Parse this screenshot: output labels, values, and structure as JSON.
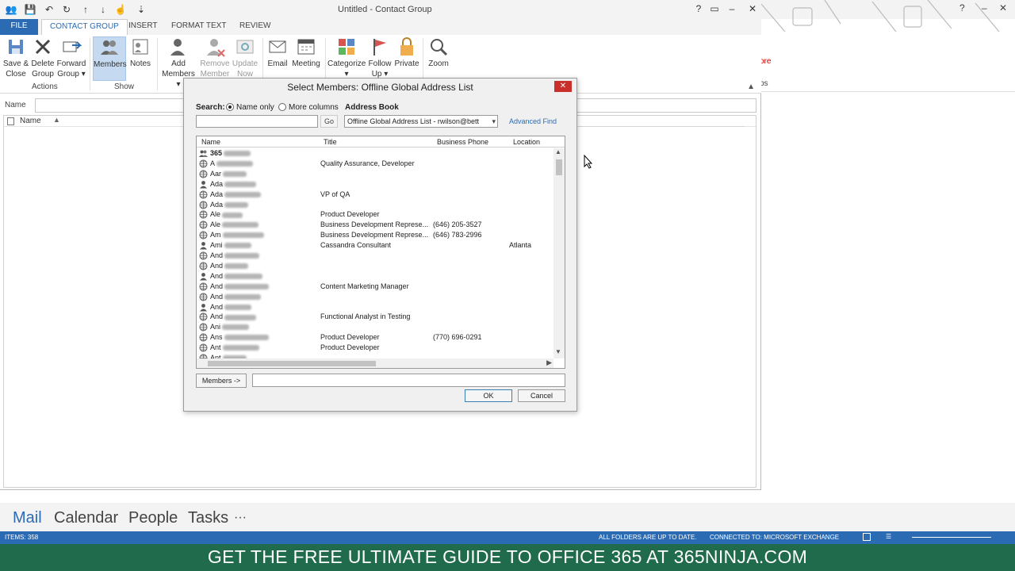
{
  "window": {
    "title": "Untitled - Contact Group",
    "controls": [
      "?",
      "▭",
      "–",
      "☐",
      "✕"
    ]
  },
  "quick_access": [
    "contacts-icon",
    "save-icon",
    "undo-icon",
    "redo-icon",
    "up-icon",
    "down-icon",
    "touch-icon",
    "customize-icon"
  ],
  "tabs": [
    {
      "label": "FILE"
    },
    {
      "label": "CONTACT GROUP"
    },
    {
      "label": "INSERT"
    },
    {
      "label": "FORMAT TEXT"
    },
    {
      "label": "REVIEW"
    }
  ],
  "ribbon": {
    "save_close": "Save &\nClose",
    "delete_group": "Delete\nGroup",
    "forward_group": "Forward\nGroup ▾",
    "actions_label": "Actions",
    "members": "Members",
    "notes": "Notes",
    "show_label": "Show",
    "add_members": "Add\nMembers ▾",
    "remove_member": "Remove\nMember",
    "update_now": "Update\nNow",
    "email": "Email",
    "meeting": "Meeting",
    "categorize": "Categorize\n▾",
    "follow_up": "Follow\nUp ▾",
    "private": "Private",
    "zoom": "Zoom"
  },
  "name_field": {
    "label": "Name",
    "value": ""
  },
  "list": {
    "column_name": "Name"
  },
  "dialog": {
    "title": "Select Members: Offline Global Address List",
    "close": "✕",
    "search_label": "Search:",
    "name_only": "Name only",
    "more_columns": "More columns",
    "address_book_label": "Address Book",
    "search_value": "",
    "go": "Go",
    "address_book_value": "Offline Global Address List - rwilson@bett",
    "advanced_find": "Advanced Find",
    "columns": {
      "name": "Name",
      "title": "Title",
      "phone": "Business Phone",
      "location": "Location"
    },
    "rows": [
      {
        "name": "365",
        "title": "",
        "phone": "",
        "location": "",
        "type": "group"
      },
      {
        "name": "A",
        "title": "Quality Assurance, Developer",
        "phone": "",
        "location": "",
        "type": "globe"
      },
      {
        "name": "Aar",
        "title": "",
        "phone": "",
        "location": "",
        "type": "globe"
      },
      {
        "name": "Ada",
        "title": "",
        "phone": "",
        "location": "",
        "type": "person"
      },
      {
        "name": "Ada",
        "title": "VP of QA",
        "phone": "",
        "location": "",
        "type": "globe"
      },
      {
        "name": "Ada",
        "title": "",
        "phone": "",
        "location": "",
        "type": "globe"
      },
      {
        "name": "Ale",
        "title": "Product Developer",
        "phone": "",
        "location": "",
        "type": "globe"
      },
      {
        "name": "Ale",
        "title": "Business Development Represe...",
        "phone": "(646) 205-3527",
        "location": "",
        "type": "globe"
      },
      {
        "name": "Am",
        "title": "Business Development Represe...",
        "phone": "(646) 783-2996",
        "location": "",
        "type": "globe"
      },
      {
        "name": "Ami",
        "title": "Cassandra Consultant",
        "phone": "",
        "location": "Atlanta",
        "type": "person"
      },
      {
        "name": "And",
        "title": "",
        "phone": "",
        "location": "",
        "type": "globe"
      },
      {
        "name": "And",
        "title": "",
        "phone": "",
        "location": "",
        "type": "globe"
      },
      {
        "name": "And",
        "title": "",
        "phone": "",
        "location": "",
        "type": "person"
      },
      {
        "name": "And",
        "title": "Content Marketing Manager",
        "phone": "",
        "location": "",
        "type": "globe"
      },
      {
        "name": "And",
        "title": "",
        "phone": "",
        "location": "",
        "type": "globe"
      },
      {
        "name": "And",
        "title": "",
        "phone": "",
        "location": "",
        "type": "person"
      },
      {
        "name": "And",
        "title": "Functional Analyst in Testing",
        "phone": "",
        "location": "",
        "type": "globe"
      },
      {
        "name": "Ani",
        "title": "",
        "phone": "",
        "location": "",
        "type": "globe"
      },
      {
        "name": "Ans",
        "title": "Product Developer",
        "phone": "(770) 696-0291",
        "location": "",
        "type": "globe"
      },
      {
        "name": "Ant",
        "title": "Product Developer",
        "phone": "",
        "location": "",
        "type": "globe"
      },
      {
        "name": "Ant",
        "title": "",
        "phone": "",
        "location": "",
        "type": "globe"
      }
    ],
    "members_button": "Members ->",
    "members_value": "",
    "ok": "OK",
    "cancel": "Cancel"
  },
  "background": {
    "frag1": "ore",
    "frag2": "ps"
  },
  "nav": {
    "mail": "Mail",
    "calendar": "Calendar",
    "people": "People",
    "tasks": "Tasks",
    "more": "···"
  },
  "status": {
    "items": "ITEMS: 358",
    "folders": "ALL FOLDERS ARE UP TO DATE.",
    "connected": "CONNECTED TO: MICROSOFT EXCHANGE"
  },
  "banner": "GET THE FREE ULTIMATE GUIDE TO OFFICE 365 AT 365NINJA.COM",
  "colors": {
    "accent": "#2b6bb3",
    "banner": "#1f6b4c",
    "close": "#c9302c"
  }
}
